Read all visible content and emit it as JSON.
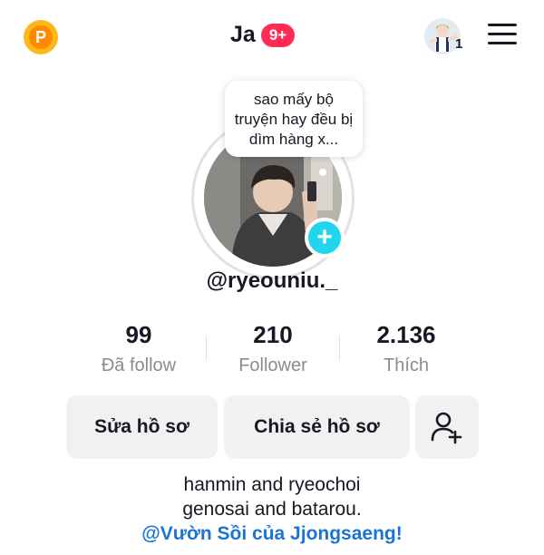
{
  "header": {
    "coin_letter": "P",
    "title": "Ja",
    "badge": "9+",
    "mini_count": "1"
  },
  "profile": {
    "bubble_text": "sao mấy bộ truyện hay đều bị dìm hàng x...",
    "username": "@ryeouniu._",
    "add_symbol": "+"
  },
  "stats": [
    {
      "value": "99",
      "label": "Đã follow"
    },
    {
      "value": "210",
      "label": "Follower"
    },
    {
      "value": "2.136",
      "label": "Thích"
    }
  ],
  "actions": {
    "edit": "Sửa hồ sơ",
    "share": "Chia sẻ hồ sơ"
  },
  "bio": {
    "line1": "hanmin and ryeochoi",
    "line2": "genosai and batarou.",
    "link": "@Vườn Sồi của Jjongsaeng!"
  },
  "colors": {
    "badge": "#fe2c55",
    "plus": "#20d5ec",
    "link": "#1b74d1",
    "coin": "#ffb81c"
  },
  "icons": {
    "coin": "coin-icon",
    "menu": "hamburger-menu-icon",
    "add_friend": "add-friend-icon",
    "plus": "plus-icon"
  }
}
